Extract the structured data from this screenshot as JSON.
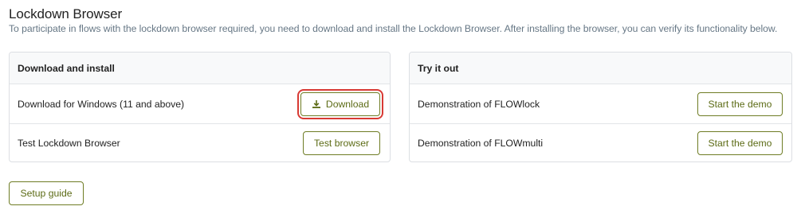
{
  "page": {
    "title": "Lockdown Browser",
    "subtitle": "To participate in flows with the lockdown browser required, you need to download and install the Lockdown Browser. After installing the browser, you can verify its functionality below."
  },
  "download_card": {
    "header": "Download and install",
    "rows": [
      {
        "label": "Download for Windows (11 and above)",
        "button": "Download",
        "icon": "download-icon"
      },
      {
        "label": "Test Lockdown Browser",
        "button": "Test browser"
      }
    ]
  },
  "try_card": {
    "header": "Try it out",
    "rows": [
      {
        "label": "Demonstration of FLOWlock",
        "button": "Start the demo"
      },
      {
        "label": "Demonstration of FLOWmulti",
        "button": "Start the demo"
      }
    ]
  },
  "footer": {
    "setup_guide": "Setup guide"
  },
  "colors": {
    "accent": "#5c6b15",
    "button_border": "#6e7c24",
    "highlight": "#d83a34",
    "muted_text": "#667785"
  }
}
